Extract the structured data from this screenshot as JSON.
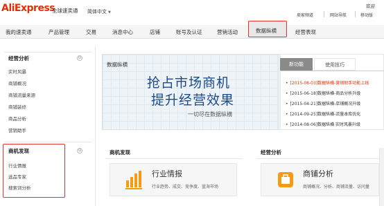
{
  "header": {
    "logo": "AliExpress",
    "logo_sub": "全球速卖通",
    "language": "简体中文",
    "utility_links": [
      "卖家频道",
      "网站导航",
      "移动版"
    ],
    "welcome": "欢迎"
  },
  "nav": {
    "items": [
      "我的速卖通",
      "产品管理",
      "交易",
      "消息中心",
      "店铺",
      "账号及认证",
      "营销活动"
    ],
    "active": "数据纵横",
    "after_active": "经营表现"
  },
  "sidebar": {
    "section1": {
      "title": "经营分析",
      "toggle": "⊖",
      "items": [
        "实时风暴",
        "商铺概况",
        "商铺流量来源",
        "商铺装修",
        "商品分析",
        "营销助手"
      ]
    },
    "section2": {
      "title": "商机发现",
      "toggle": "⊖",
      "items": [
        "行业情报",
        "选品专家",
        "搜索词分析"
      ]
    }
  },
  "banner": {
    "label": "数据纵横",
    "title1": "抢占市场商机",
    "title2": "提升经营效果",
    "subtitle": "一切尽在数据纵横"
  },
  "notice": {
    "tab_active": "新功能",
    "tab_inactive": "使用技巧",
    "items": [
      {
        "text": "[2015-08-03]数据纵横-营销助手功能上线",
        "hot": true
      },
      {
        "text": "[2015-06-18]数据纵横-商品分析升级",
        "hot": false
      },
      {
        "text": "[2015-04-21]数据纵横-店铺概况升级",
        "hot": false
      },
      {
        "text": "[2014-09-25]数据纵横-流量本库优化",
        "hot": false
      },
      {
        "text": "[2014-08-06]数据纵横 实时风暴升级",
        "hot": false
      }
    ]
  },
  "sections": {
    "left": {
      "title": "商机发现",
      "card_title": "行业情报",
      "card_desc": "行业趋势、成交、竞争度、蓝海市场"
    },
    "right": {
      "title": "经营分析",
      "card_title": "商铺分析",
      "card_desc": "商铺概况、分析、商铺流量、访问量"
    }
  },
  "colors": {
    "brand": "#e62e04",
    "highlight_border": "#e8322d",
    "banner_text": "#1a4c8c",
    "icon_orange": "#f39c12"
  }
}
